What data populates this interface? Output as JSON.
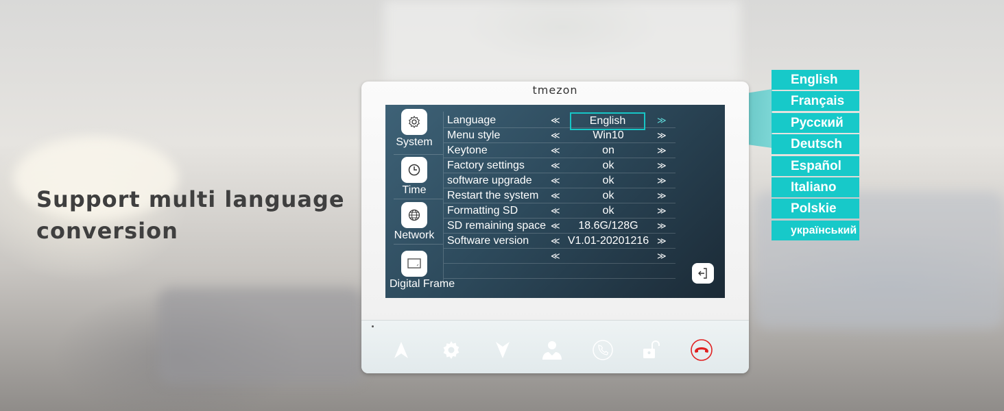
{
  "headline": {
    "line1": "Support multi language",
    "line2": "conversion"
  },
  "device": {
    "brand": "tmezon",
    "sidebar": [
      {
        "label": "System",
        "icon": "gear-icon"
      },
      {
        "label": "Time",
        "icon": "clock-icon"
      },
      {
        "label": "Network",
        "icon": "globe-icon"
      },
      {
        "label": "Digital Frame",
        "icon": "picture-frame-icon"
      }
    ],
    "settings": [
      {
        "label": "Language",
        "value": "English",
        "selected": true
      },
      {
        "label": "Menu style",
        "value": "Win10"
      },
      {
        "label": "Keytone",
        "value": "on"
      },
      {
        "label": "Factory settings",
        "value": "ok"
      },
      {
        "label": "software upgrade",
        "value": "ok"
      },
      {
        "label": "Restart the system",
        "value": "ok"
      },
      {
        "label": "Formatting SD",
        "value": "ok"
      },
      {
        "label": "SD remaining space",
        "value": "18.6G/128G"
      },
      {
        "label": "Software version",
        "value": "V1.01-20201216"
      },
      {
        "label": "",
        "value": ""
      }
    ],
    "arrow_left": "≪",
    "arrow_right": "≫",
    "keys": [
      "up-arrow-icon",
      "settings-gear-icon",
      "down-arrow-icon",
      "contacts-icon",
      "call-icon",
      "unlock-icon",
      "hang-up-icon"
    ]
  },
  "languages": [
    "English",
    "Français",
    "Русский",
    "Deutsch",
    "Español",
    "Italiano",
    "Polskie",
    "український"
  ],
  "colors": {
    "accent": "#17c9c9",
    "hangup": "#e02020",
    "headline": "#3f3f3f"
  }
}
